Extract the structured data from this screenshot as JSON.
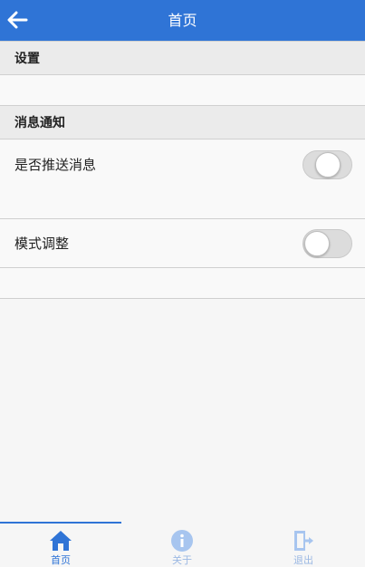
{
  "header": {
    "title": "首页"
  },
  "sections": [
    {
      "title": "设置"
    },
    {
      "title": "消息通知"
    }
  ],
  "settings": [
    {
      "label": "是否推送消息",
      "toggle_on": false
    },
    {
      "label": "模式调整",
      "toggle_on": false
    }
  ],
  "tabbar": {
    "items": [
      {
        "label": "首页",
        "icon": "home-icon",
        "active": true
      },
      {
        "label": "关于",
        "icon": "info-icon",
        "active": false
      },
      {
        "label": "退出",
        "icon": "exit-icon",
        "active": false
      }
    ]
  },
  "colors": {
    "accent": "#2f74d6",
    "inactive_icon": "#a7c5ef"
  }
}
